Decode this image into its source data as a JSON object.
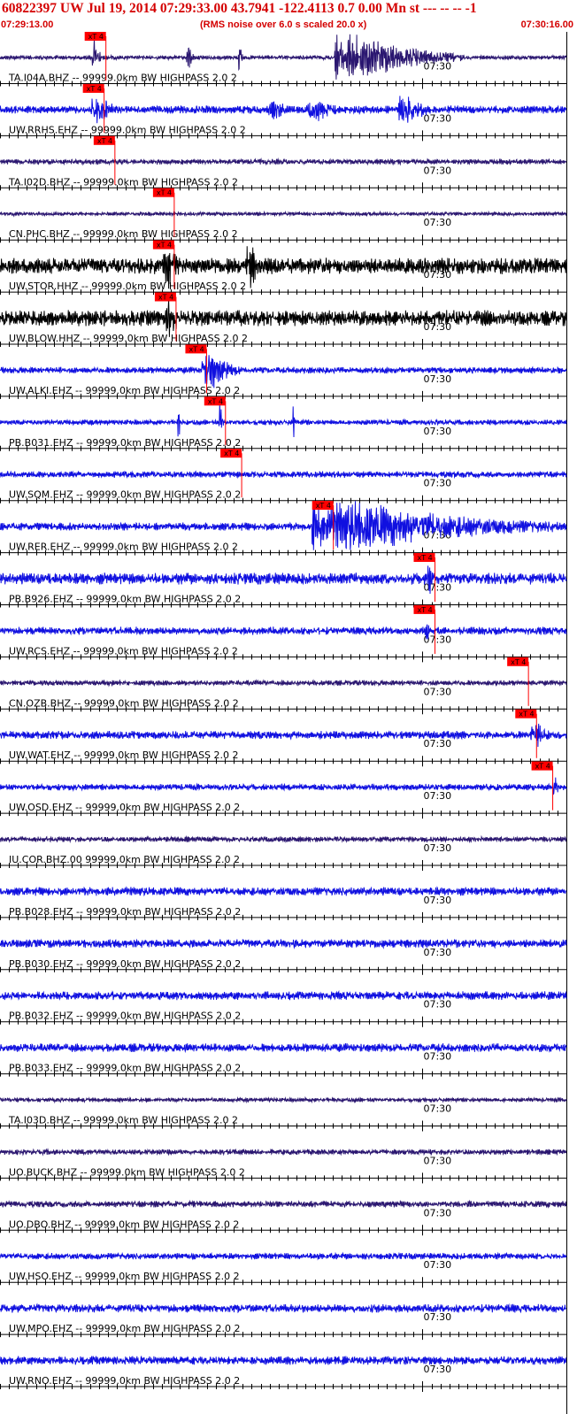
{
  "title": "60822397 UW Jul 19, 2014 07:29:33.00   43.7941 -122.4113  0.7 0.00 Mn st --- -- --   -1",
  "subtitle": "(RMS noise over 6.0 s scaled 20.0 x)",
  "time_start": "07:29:13.00",
  "time_end": "07:30:16.00",
  "tick_time_label": "07:30",
  "pick_label": "xT 4",
  "colors": {
    "header_red": "#d40000",
    "pick_red": "#ff0000",
    "navy": "#2a1670",
    "blue": "#1010e0",
    "black": "#000000"
  },
  "chart_data": {
    "type": "seismogram",
    "x_range_s": [
      0,
      63
    ],
    "x_unit": "s since 07:29:13.00",
    "tick_interval_s": 1,
    "major_tick_at_s": 47,
    "traces": [
      {
        "label": "TA.I04A.BHZ -- 99999.0km BW  HIGHPASS  2.0  2",
        "color": "navy",
        "pick_s": 10.6,
        "bursts": [
          [
            10.3,
            1.2,
            0.8
          ],
          [
            20.8,
            0.8,
            0.7
          ],
          [
            26.5,
            0.8,
            0.6
          ],
          [
            37.5,
            14,
            1.0
          ],
          [
            43,
            2,
            0.6
          ]
        ],
        "noise": 0.08
      },
      {
        "label": "UW.RRHS.EHZ -- 99999.0km BW  HIGHPASS  2.0  2",
        "color": "blue",
        "pick_s": 10.4,
        "bursts": [
          [
            10.3,
            4,
            0.6
          ],
          [
            30,
            4,
            0.4
          ],
          [
            34.5,
            5,
            0.5
          ],
          [
            44.5,
            5,
            0.55
          ]
        ],
        "noise": 0.15
      },
      {
        "label": "TA.I02D.BHZ -- 99999.0km BW  HIGHPASS  2.0  2",
        "color": "navy",
        "pick_s": 11.6,
        "bursts": [],
        "noise": 0.1
      },
      {
        "label": "CN.PHC.BHZ -- 99999.0km BW  HIGHPASS  2.0  2",
        "color": "navy",
        "pick_s": 18.2,
        "bursts": [],
        "noise": 0.07
      },
      {
        "label": "UW.STOR.HHZ -- 99999.0km BW  HIGHPASS  2.0  2",
        "color": "black",
        "pick_s": 18.2,
        "bursts": [
          [
            18.3,
            3,
            0.9
          ],
          [
            27.5,
            2.5,
            0.9
          ]
        ],
        "noise": 0.3
      },
      {
        "label": "UW.BLOW.HHZ -- 99999.0km BW  HIGHPASS  2.0  2",
        "color": "black",
        "pick_s": 18.4,
        "bursts": [
          [
            18.6,
            2,
            0.9
          ]
        ],
        "noise": 0.3
      },
      {
        "label": "UW.ALKI.EHZ -- 99999.0km BW  HIGHPASS  2.0  2",
        "color": "blue",
        "pick_s": 21.8,
        "bursts": [
          [
            22.7,
            4.5,
            0.8
          ]
        ],
        "noise": 0.12
      },
      {
        "label": "PB.B031.EHZ -- 99999.0km BW  HIGHPASS  2.0  2",
        "color": "blue",
        "pick_s": 23.9,
        "bursts": [
          [
            19.8,
            0.4,
            0.8
          ],
          [
            24.4,
            0.5,
            0.9
          ],
          [
            32.6,
            0.4,
            0.7
          ]
        ],
        "noise": 0.1
      },
      {
        "label": "UW.SQM.EHZ -- 99999.0km BW  HIGHPASS  2.0  2",
        "color": "blue",
        "pick_s": 25.7,
        "bursts": [],
        "noise": 0.12
      },
      {
        "label": "UW.RER.EHZ -- 99999.0km BW  HIGHPASS  2.0  2",
        "color": "blue",
        "pick_s": 35.9,
        "bursts": [
          [
            35,
            30,
            1.0
          ]
        ],
        "noise": 0.15
      },
      {
        "label": "PB.B926.EHZ -- 99999.0km BW  HIGHPASS  2.0  2",
        "color": "blue",
        "pick_s": 47.2,
        "bursts": [
          [
            47.6,
            0.8,
            0.8
          ]
        ],
        "noise": 0.22
      },
      {
        "label": "UW.RCS.EHZ -- 99999.0km BW  HIGHPASS  2.0  2",
        "color": "blue",
        "pick_s": 47.2,
        "bursts": [
          [
            47.3,
            1,
            0.5
          ]
        ],
        "noise": 0.15
      },
      {
        "label": "CN.OZB.BHZ -- 99999.0km BW  HIGHPASS  2.0  2",
        "color": "navy",
        "pick_s": 57.6,
        "bursts": [],
        "noise": 0.1
      },
      {
        "label": "UW.WAT.EHZ -- 99999.0km BW  HIGHPASS  2.0  2",
        "color": "blue",
        "pick_s": 58.5,
        "bursts": [
          [
            59.2,
            3,
            0.5
          ]
        ],
        "noise": 0.15
      },
      {
        "label": "UW.OSD.EHZ -- 99999.0km BW  HIGHPASS  2.0  2",
        "color": "blue",
        "pick_s": 60.3,
        "bursts": [
          [
            61.5,
            1.2,
            0.5
          ]
        ],
        "noise": 0.12
      },
      {
        "label": "IU.COR.BHZ.00 99999.0km BW  HIGHPASS  2.0  2",
        "color": "navy",
        "pick_s": null,
        "bursts": [],
        "noise": 0.1
      },
      {
        "label": "PB.B028.EHZ -- 99999.0km BW  HIGHPASS  2.0  2",
        "color": "blue",
        "pick_s": null,
        "bursts": [],
        "noise": 0.16
      },
      {
        "label": "PB.B030.EHZ -- 99999.0km BW  HIGHPASS  2.0  2",
        "color": "blue",
        "pick_s": null,
        "bursts": [],
        "noise": 0.16
      },
      {
        "label": "PB.B032.EHZ -- 99999.0km BW  HIGHPASS  2.0  2",
        "color": "blue",
        "pick_s": null,
        "bursts": [],
        "noise": 0.16
      },
      {
        "label": "PB.B033.EHZ -- 99999.0km BW  HIGHPASS  2.0  2",
        "color": "blue",
        "pick_s": null,
        "bursts": [],
        "noise": 0.16
      },
      {
        "label": "TA.I03D.BHZ -- 99999.0km BW  HIGHPASS  2.0  2",
        "color": "navy",
        "pick_s": null,
        "bursts": [],
        "noise": 0.08
      },
      {
        "label": "UO.BUCK.BHZ -- 99999.0km BW  HIGHPASS  2.0  2",
        "color": "navy",
        "pick_s": null,
        "bursts": [],
        "noise": 0.1
      },
      {
        "label": "UO.DBO.BHZ -- 99999.0km BW  HIGHPASS  2.0  2",
        "color": "navy",
        "pick_s": null,
        "bursts": [],
        "noise": 0.12
      },
      {
        "label": "UW.HSO.EHZ -- 99999.0km BW  HIGHPASS  2.0  2",
        "color": "blue",
        "pick_s": null,
        "bursts": [],
        "noise": 0.12
      },
      {
        "label": "UW.MPO.EHZ -- 99999.0km BW  HIGHPASS  2.0  2",
        "color": "blue",
        "pick_s": null,
        "bursts": [],
        "noise": 0.16
      },
      {
        "label": "UW.RNO.EHZ -- 99999.0km BW  HIGHPASS  2.0  2",
        "color": "blue",
        "pick_s": null,
        "bursts": [],
        "noise": 0.16
      }
    ]
  }
}
